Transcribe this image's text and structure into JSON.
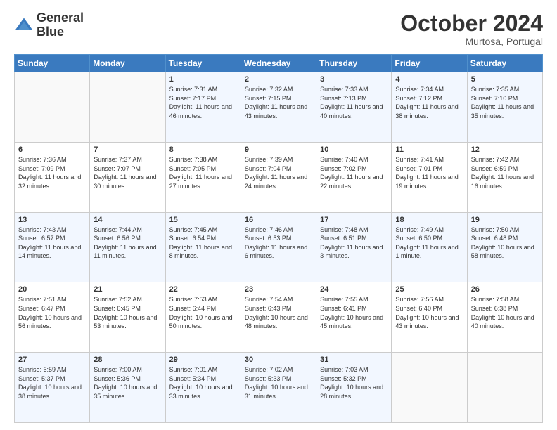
{
  "header": {
    "logo_line1": "General",
    "logo_line2": "Blue",
    "month_year": "October 2024",
    "location": "Murtosa, Portugal"
  },
  "days_of_week": [
    "Sunday",
    "Monday",
    "Tuesday",
    "Wednesday",
    "Thursday",
    "Friday",
    "Saturday"
  ],
  "weeks": [
    [
      {
        "day": "",
        "info": ""
      },
      {
        "day": "",
        "info": ""
      },
      {
        "day": "1",
        "sunrise": "Sunrise: 7:31 AM",
        "sunset": "Sunset: 7:17 PM",
        "daylight": "Daylight: 11 hours and 46 minutes."
      },
      {
        "day": "2",
        "sunrise": "Sunrise: 7:32 AM",
        "sunset": "Sunset: 7:15 PM",
        "daylight": "Daylight: 11 hours and 43 minutes."
      },
      {
        "day": "3",
        "sunrise": "Sunrise: 7:33 AM",
        "sunset": "Sunset: 7:13 PM",
        "daylight": "Daylight: 11 hours and 40 minutes."
      },
      {
        "day": "4",
        "sunrise": "Sunrise: 7:34 AM",
        "sunset": "Sunset: 7:12 PM",
        "daylight": "Daylight: 11 hours and 38 minutes."
      },
      {
        "day": "5",
        "sunrise": "Sunrise: 7:35 AM",
        "sunset": "Sunset: 7:10 PM",
        "daylight": "Daylight: 11 hours and 35 minutes."
      }
    ],
    [
      {
        "day": "6",
        "sunrise": "Sunrise: 7:36 AM",
        "sunset": "Sunset: 7:09 PM",
        "daylight": "Daylight: 11 hours and 32 minutes."
      },
      {
        "day": "7",
        "sunrise": "Sunrise: 7:37 AM",
        "sunset": "Sunset: 7:07 PM",
        "daylight": "Daylight: 11 hours and 30 minutes."
      },
      {
        "day": "8",
        "sunrise": "Sunrise: 7:38 AM",
        "sunset": "Sunset: 7:05 PM",
        "daylight": "Daylight: 11 hours and 27 minutes."
      },
      {
        "day": "9",
        "sunrise": "Sunrise: 7:39 AM",
        "sunset": "Sunset: 7:04 PM",
        "daylight": "Daylight: 11 hours and 24 minutes."
      },
      {
        "day": "10",
        "sunrise": "Sunrise: 7:40 AM",
        "sunset": "Sunset: 7:02 PM",
        "daylight": "Daylight: 11 hours and 22 minutes."
      },
      {
        "day": "11",
        "sunrise": "Sunrise: 7:41 AM",
        "sunset": "Sunset: 7:01 PM",
        "daylight": "Daylight: 11 hours and 19 minutes."
      },
      {
        "day": "12",
        "sunrise": "Sunrise: 7:42 AM",
        "sunset": "Sunset: 6:59 PM",
        "daylight": "Daylight: 11 hours and 16 minutes."
      }
    ],
    [
      {
        "day": "13",
        "sunrise": "Sunrise: 7:43 AM",
        "sunset": "Sunset: 6:57 PM",
        "daylight": "Daylight: 11 hours and 14 minutes."
      },
      {
        "day": "14",
        "sunrise": "Sunrise: 7:44 AM",
        "sunset": "Sunset: 6:56 PM",
        "daylight": "Daylight: 11 hours and 11 minutes."
      },
      {
        "day": "15",
        "sunrise": "Sunrise: 7:45 AM",
        "sunset": "Sunset: 6:54 PM",
        "daylight": "Daylight: 11 hours and 8 minutes."
      },
      {
        "day": "16",
        "sunrise": "Sunrise: 7:46 AM",
        "sunset": "Sunset: 6:53 PM",
        "daylight": "Daylight: 11 hours and 6 minutes."
      },
      {
        "day": "17",
        "sunrise": "Sunrise: 7:48 AM",
        "sunset": "Sunset: 6:51 PM",
        "daylight": "Daylight: 11 hours and 3 minutes."
      },
      {
        "day": "18",
        "sunrise": "Sunrise: 7:49 AM",
        "sunset": "Sunset: 6:50 PM",
        "daylight": "Daylight: 11 hours and 1 minute."
      },
      {
        "day": "19",
        "sunrise": "Sunrise: 7:50 AM",
        "sunset": "Sunset: 6:48 PM",
        "daylight": "Daylight: 10 hours and 58 minutes."
      }
    ],
    [
      {
        "day": "20",
        "sunrise": "Sunrise: 7:51 AM",
        "sunset": "Sunset: 6:47 PM",
        "daylight": "Daylight: 10 hours and 56 minutes."
      },
      {
        "day": "21",
        "sunrise": "Sunrise: 7:52 AM",
        "sunset": "Sunset: 6:45 PM",
        "daylight": "Daylight: 10 hours and 53 minutes."
      },
      {
        "day": "22",
        "sunrise": "Sunrise: 7:53 AM",
        "sunset": "Sunset: 6:44 PM",
        "daylight": "Daylight: 10 hours and 50 minutes."
      },
      {
        "day": "23",
        "sunrise": "Sunrise: 7:54 AM",
        "sunset": "Sunset: 6:43 PM",
        "daylight": "Daylight: 10 hours and 48 minutes."
      },
      {
        "day": "24",
        "sunrise": "Sunrise: 7:55 AM",
        "sunset": "Sunset: 6:41 PM",
        "daylight": "Daylight: 10 hours and 45 minutes."
      },
      {
        "day": "25",
        "sunrise": "Sunrise: 7:56 AM",
        "sunset": "Sunset: 6:40 PM",
        "daylight": "Daylight: 10 hours and 43 minutes."
      },
      {
        "day": "26",
        "sunrise": "Sunrise: 7:58 AM",
        "sunset": "Sunset: 6:38 PM",
        "daylight": "Daylight: 10 hours and 40 minutes."
      }
    ],
    [
      {
        "day": "27",
        "sunrise": "Sunrise: 6:59 AM",
        "sunset": "Sunset: 5:37 PM",
        "daylight": "Daylight: 10 hours and 38 minutes."
      },
      {
        "day": "28",
        "sunrise": "Sunrise: 7:00 AM",
        "sunset": "Sunset: 5:36 PM",
        "daylight": "Daylight: 10 hours and 35 minutes."
      },
      {
        "day": "29",
        "sunrise": "Sunrise: 7:01 AM",
        "sunset": "Sunset: 5:34 PM",
        "daylight": "Daylight: 10 hours and 33 minutes."
      },
      {
        "day": "30",
        "sunrise": "Sunrise: 7:02 AM",
        "sunset": "Sunset: 5:33 PM",
        "daylight": "Daylight: 10 hours and 31 minutes."
      },
      {
        "day": "31",
        "sunrise": "Sunrise: 7:03 AM",
        "sunset": "Sunset: 5:32 PM",
        "daylight": "Daylight: 10 hours and 28 minutes."
      },
      {
        "day": "",
        "info": ""
      },
      {
        "day": "",
        "info": ""
      }
    ]
  ]
}
